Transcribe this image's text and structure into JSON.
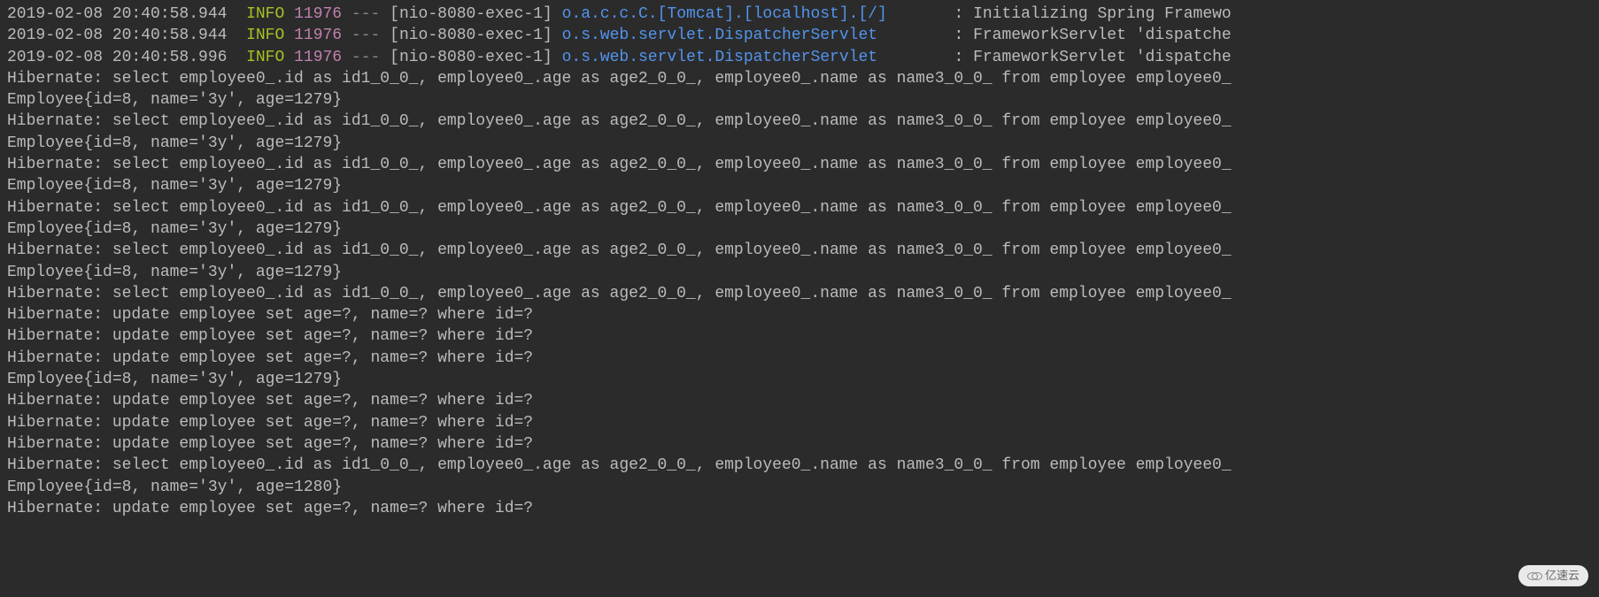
{
  "springLines": [
    {
      "timestamp": "2019-02-08 20:40:58.944",
      "level": "INFO",
      "pid": "11976",
      "sep": "---",
      "thread": "[nio-8080-exec-1]",
      "logger": "o.a.c.c.C.[Tomcat].[localhost].[/]      ",
      "message": " : Initializing Spring Framewo"
    },
    {
      "timestamp": "2019-02-08 20:40:58.944",
      "level": "INFO",
      "pid": "11976",
      "sep": "---",
      "thread": "[nio-8080-exec-1]",
      "logger": "o.s.web.servlet.DispatcherServlet       ",
      "message": " : FrameworkServlet 'dispatche"
    },
    {
      "timestamp": "2019-02-08 20:40:58.996",
      "level": "INFO",
      "pid": "11976",
      "sep": "---",
      "thread": "[nio-8080-exec-1]",
      "logger": "o.s.web.servlet.DispatcherServlet       ",
      "message": " : FrameworkServlet 'dispatche"
    }
  ],
  "plainLines": [
    "Hibernate: select employee0_.id as id1_0_0_, employee0_.age as age2_0_0_, employee0_.name as name3_0_0_ from employee employee0_ ",
    "Employee{id=8, name='3y', age=1279}",
    "Hibernate: select employee0_.id as id1_0_0_, employee0_.age as age2_0_0_, employee0_.name as name3_0_0_ from employee employee0_ ",
    "Employee{id=8, name='3y', age=1279}",
    "Hibernate: select employee0_.id as id1_0_0_, employee0_.age as age2_0_0_, employee0_.name as name3_0_0_ from employee employee0_ ",
    "Employee{id=8, name='3y', age=1279}",
    "Hibernate: select employee0_.id as id1_0_0_, employee0_.age as age2_0_0_, employee0_.name as name3_0_0_ from employee employee0_ ",
    "Employee{id=8, name='3y', age=1279}",
    "Hibernate: select employee0_.id as id1_0_0_, employee0_.age as age2_0_0_, employee0_.name as name3_0_0_ from employee employee0_ ",
    "Employee{id=8, name='3y', age=1279}",
    "Hibernate: select employee0_.id as id1_0_0_, employee0_.age as age2_0_0_, employee0_.name as name3_0_0_ from employee employee0_ ",
    "Hibernate: update employee set age=?, name=? where id=?",
    "Hibernate: update employee set age=?, name=? where id=?",
    "Hibernate: update employee set age=?, name=? where id=?",
    "Employee{id=8, name='3y', age=1279}",
    "Hibernate: update employee set age=?, name=? where id=?",
    "Hibernate: update employee set age=?, name=? where id=?",
    "Hibernate: update employee set age=?, name=? where id=?",
    "Hibernate: select employee0_.id as id1_0_0_, employee0_.age as age2_0_0_, employee0_.name as name3_0_0_ from employee employee0_ ",
    "Employee{id=8, name='3y', age=1280}",
    "Hibernate: update employee set age=?, name=? where id=?"
  ],
  "watermark": "亿速云"
}
